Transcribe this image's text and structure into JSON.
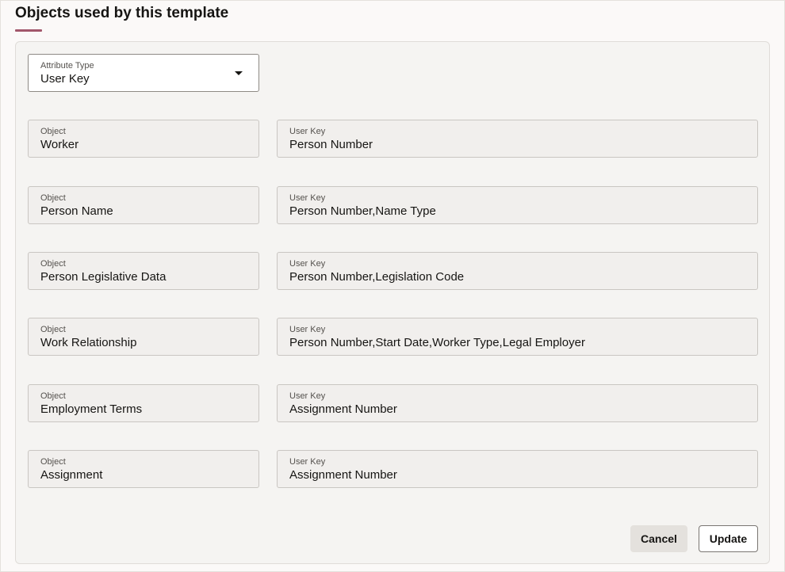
{
  "title": "Objects used by this template",
  "attribute_type": {
    "label": "Attribute Type",
    "value": "User Key"
  },
  "rows": [
    {
      "object_label": "Object",
      "object_value": "Worker",
      "key_label": "User Key",
      "key_value": "Person Number"
    },
    {
      "object_label": "Object",
      "object_value": "Person Name",
      "key_label": "User Key",
      "key_value": "Person Number,Name Type"
    },
    {
      "object_label": "Object",
      "object_value": "Person Legislative Data",
      "key_label": "User Key",
      "key_value": "Person Number,Legislation Code"
    },
    {
      "object_label": "Object",
      "object_value": "Work Relationship",
      "key_label": "User Key",
      "key_value": "Person Number,Start Date,Worker Type,Legal Employer"
    },
    {
      "object_label": "Object",
      "object_value": "Employment Terms",
      "key_label": "User Key",
      "key_value": "Assignment Number"
    },
    {
      "object_label": "Object",
      "object_value": "Assignment",
      "key_label": "User Key",
      "key_value": "Assignment Number"
    }
  ],
  "buttons": {
    "cancel": "Cancel",
    "update": "Update"
  },
  "colors": {
    "accent": "#a2576b"
  }
}
